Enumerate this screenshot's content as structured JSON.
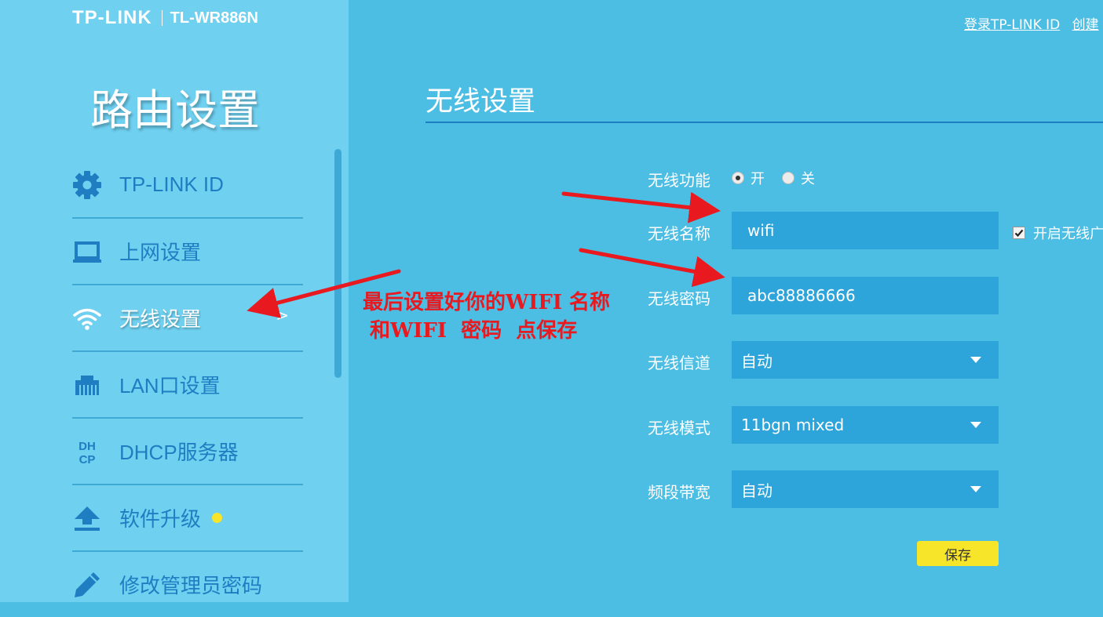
{
  "header": {
    "brand": "TP-LINK",
    "model": "TL-WR886N",
    "links": [
      "登录TP-LINK ID",
      "创建"
    ]
  },
  "sidebar": {
    "title": "路由设置",
    "items": [
      {
        "label": "TP-LINK ID",
        "icon": "gear-icon"
      },
      {
        "label": "上网设置",
        "icon": "laptop-icon"
      },
      {
        "label": "无线设置",
        "icon": "wifi-icon",
        "active": true,
        "chevron": ">"
      },
      {
        "label": "LAN口设置",
        "icon": "lan-port-icon"
      },
      {
        "label": "DHCP服务器",
        "icon": "dhcp-icon",
        "icon_text": [
          "DH",
          "CP"
        ]
      },
      {
        "label": "软件升级",
        "icon": "upload-icon",
        "has_update_badge": true
      },
      {
        "label": "修改管理员密码",
        "icon": "pencil-icon"
      }
    ]
  },
  "main": {
    "title": "无线设置",
    "form": {
      "wireless_function": {
        "label": "无线功能",
        "options": [
          "开",
          "关"
        ],
        "selected": "开"
      },
      "ssid": {
        "label": "无线名称",
        "value": "wifi"
      },
      "broadcast": {
        "label": "开启无线广",
        "checked": true
      },
      "password": {
        "label": "无线密码",
        "value": "abc88886666"
      },
      "channel": {
        "label": "无线信道",
        "value": "自动"
      },
      "mode": {
        "label": "无线模式",
        "value": "11bgn mixed"
      },
      "bandwidth": {
        "label": "频段带宽",
        "value": "自动"
      }
    },
    "save_label": "保存"
  },
  "annotation": {
    "line1": "最后设置好你的WIFI 名称",
    "line2": " 和WIFI  密码  点保存",
    "color": "#e8191f"
  },
  "colors": {
    "background": "#4cbde3",
    "sidebar": "#6fd0f0",
    "field": "#2da4da",
    "accent_blue": "#1f7ec2",
    "save_button": "#f7e52a"
  }
}
